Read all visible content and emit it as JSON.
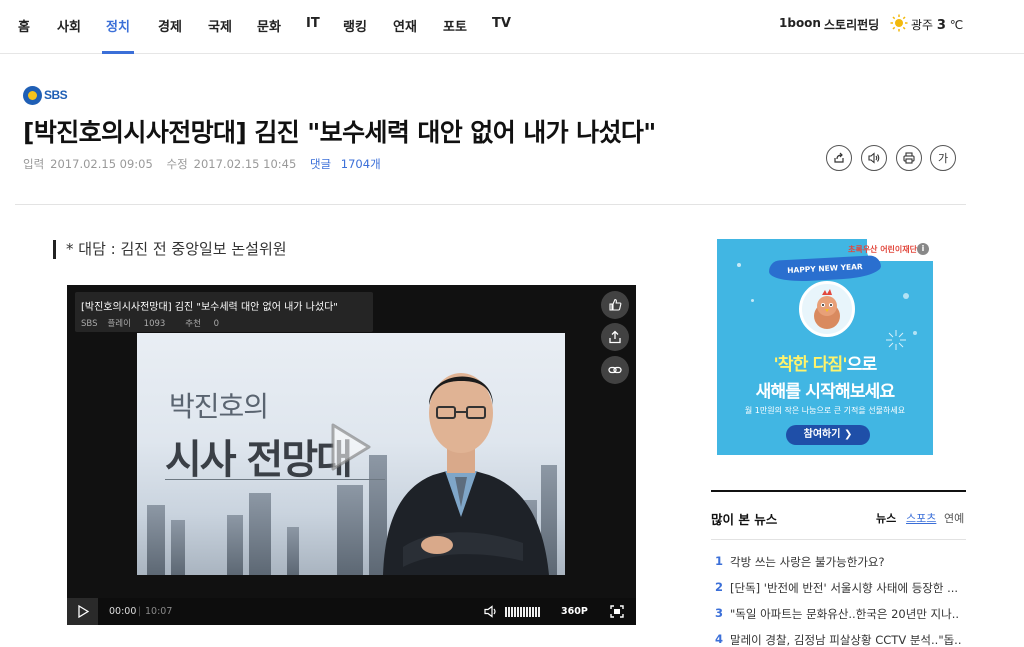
{
  "nav": {
    "items": [
      "홈",
      "사회",
      "정치",
      "경제",
      "국제",
      "문화",
      "IT",
      "랭킹",
      "연재",
      "포토",
      "TV"
    ],
    "active": "정치",
    "right_links": [
      "1boon",
      "스토리펀딩"
    ],
    "weather": {
      "city": "광주",
      "temp": "3",
      "unit": "℃",
      "icon": "sun-icon"
    }
  },
  "article": {
    "source": "SBS",
    "headline": "[박진호의시사전망대] 김진 \"보수세력 대안 없어 내가 나섰다\"",
    "input_label": "입력",
    "input_time": "2017.02.15 09:05",
    "modified_label": "수정",
    "modified_time": "2017.02.15 10:45",
    "comments_label": "댓글",
    "comments_count": "1704개",
    "tools": {
      "share_icon": "share-icon",
      "tts_icon": "speaker-icon",
      "print_icon": "print-icon",
      "font_label": "가"
    },
    "quote": "* 대담 : 김진 전 중앙일보 논설위원"
  },
  "video": {
    "title": "[박진호의시사전망대] 김진 \"보수세력 대안 없어 내가 나섰다\"",
    "channel": "SBS",
    "plays_label": "플레이",
    "plays": "1093",
    "likes_label": "추천",
    "likes": "0",
    "show_name_line1": "박진호의",
    "show_name_line2": "시사 전망대",
    "current_time": "00:00",
    "duration": "10:07",
    "quality": "360P",
    "progress": 0
  },
  "ad": {
    "brand": "초록우산 어린이재단",
    "banner": "HAPPY NEW YEAR",
    "headline_highlight": "'착한 다짐'",
    "headline_rest": "으로",
    "line2": "새해를 시작해보세요",
    "small": "월 1만원의 작은 나눔으로 큰 기적을 선물하세요",
    "button": "참여하기 ❯",
    "info": "i"
  },
  "popular": {
    "title": "많이 본 뉴스",
    "tabs": [
      "뉴스",
      "스포츠",
      "연예"
    ],
    "active_tab": "뉴스",
    "items": [
      {
        "num": "1",
        "text": "각방 쓰는 사랑은 불가능한가요?"
      },
      {
        "num": "2",
        "text": "[단독] '반전에 반전' 서울시향 사태에 등장한 ..."
      },
      {
        "num": "3",
        "text": "\"독일 아파트는 문화유산..한국은 20년만 지나.."
      },
      {
        "num": "4",
        "text": "말레이 경찰, 김정남 피살상황 CCTV 분석..\"돕.."
      }
    ]
  },
  "colors": {
    "accent": "#3b6fd8",
    "ad_bg": "#41b6e3",
    "player_bg": "#111111"
  }
}
